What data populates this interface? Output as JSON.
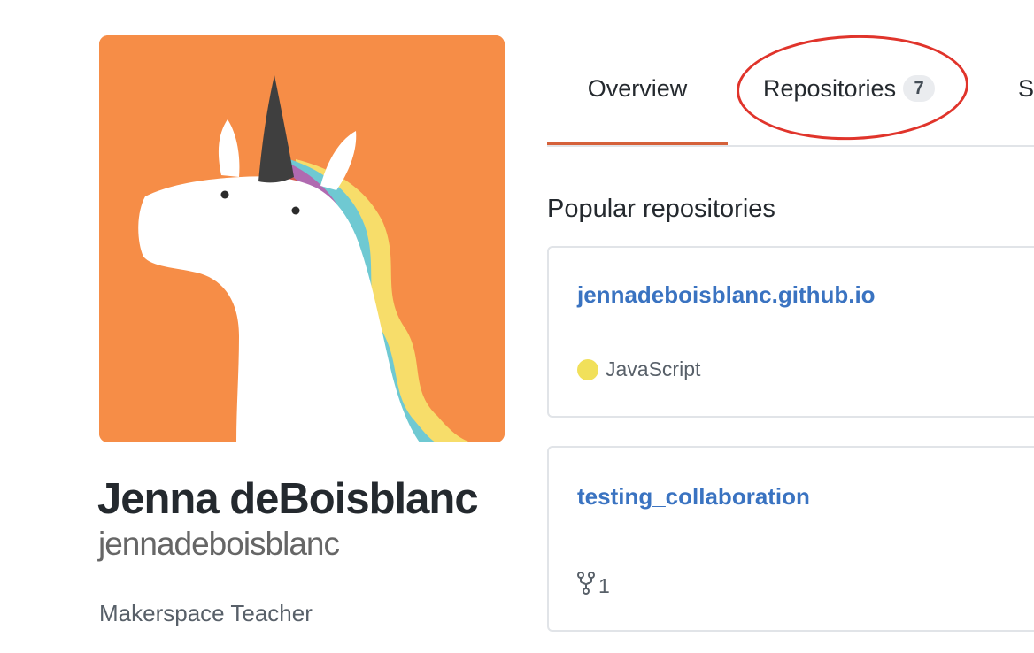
{
  "profile": {
    "fullname": "Jenna deBoisblanc",
    "username": "jennadeboisblanc",
    "bio": "Makerspace Teacher",
    "avatar": {
      "icon": "unicorn-avatar",
      "background": "#f68d47"
    }
  },
  "tabs": [
    {
      "label": "Overview",
      "selected": true
    },
    {
      "label": "Repositories",
      "count": "7",
      "selected": false,
      "annotated": true
    },
    {
      "label": "St",
      "selected": false
    }
  ],
  "popular": {
    "title": "Popular repositories",
    "repos": [
      {
        "name": "jennadeboisblanc.github.io",
        "language": "JavaScript",
        "language_color": "#f1e05a"
      },
      {
        "name": "testing_collaboration",
        "forks": "1",
        "fork_icon": "fork-icon"
      }
    ]
  },
  "colors": {
    "accent_tab_underline": "#d5613a",
    "link": "#3a73c1",
    "annotation_circle": "#e0342b"
  }
}
